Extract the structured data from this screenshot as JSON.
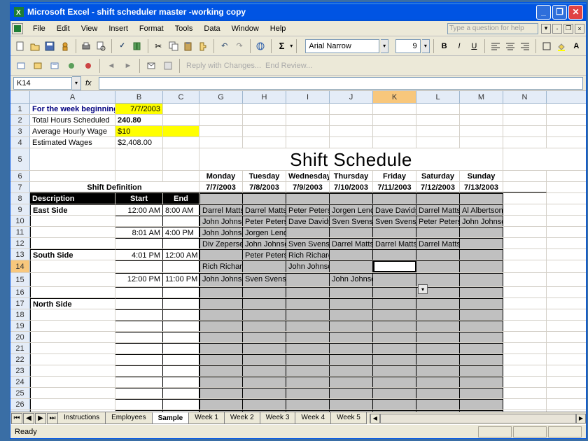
{
  "title": "Microsoft Excel - shift scheduler master -working copy",
  "menus": [
    "File",
    "Edit",
    "View",
    "Insert",
    "Format",
    "Tools",
    "Data",
    "Window",
    "Help"
  ],
  "helpPlaceholder": "Type a question for help",
  "font": {
    "name": "Arial Narrow",
    "size": "9"
  },
  "nameBox": "K14",
  "reviewBtn1": "Reply with Changes...",
  "reviewBtn2": "End Review...",
  "tabs": [
    "Instructions",
    "Employees",
    "Sample",
    "Week 1",
    "Week 2",
    "Week 3",
    "Week 4",
    "Week 5"
  ],
  "activeTab": "Sample",
  "status": "Ready",
  "columns": [
    "A",
    "B",
    "C",
    "G",
    "H",
    "I",
    "J",
    "K",
    "L",
    "M",
    "N"
  ],
  "activeCol": "K",
  "activeRow": "14",
  "sheet": {
    "r1": {
      "a": "For the week beginning:",
      "b": "7/7/2003"
    },
    "r2": {
      "a": "Total Hours Scheduled",
      "b": "240.80"
    },
    "r3": {
      "a": "Average Hourly Wage",
      "b": "$10"
    },
    "r4": {
      "a": "Estimated Wages",
      "b": "$2,408.00"
    },
    "title": "Shift Schedule",
    "days": [
      "Monday",
      "Tuesday",
      "Wednesday",
      "Thursday",
      "Friday",
      "Saturday",
      "Sunday"
    ],
    "dates": [
      "7/7/2003",
      "7/8/2003",
      "7/9/2003",
      "7/10/2003",
      "7/11/2003",
      "7/12/2003",
      "7/13/2003"
    ],
    "defHeader": "Shift Definition",
    "hdr": {
      "desc": "Description",
      "start": "Start",
      "end": "End"
    },
    "sections": [
      "East Side",
      "South Side",
      "North Side"
    ],
    "times": {
      "r9": {
        "start": "12:00 AM",
        "end": "8:00 AM"
      },
      "r11": {
        "start": "8:01 AM",
        "end": "4:00 PM"
      },
      "r13": {
        "start": "4:01 PM",
        "end": "12:00 AM"
      },
      "r15": {
        "start": "12:00 PM",
        "end": "11:00 PM"
      }
    },
    "assign": {
      "r9": [
        "Darrel Mattson",
        "Darrel Mattson",
        "Peter Peterson",
        "Jorgen Leno",
        "Dave Davidson",
        "Darrel Mattson",
        "Al Albertson"
      ],
      "r10": [
        "John Johnson",
        "Peter Peterson",
        "Dave Davidson",
        "Sven Svenson",
        "Sven Svenson",
        "Peter Peterson",
        "John Johnson"
      ],
      "r11": [
        "John Johnson",
        "Jorgen Leno",
        "",
        "",
        "",
        "",
        ""
      ],
      "r12": [
        "Div Zepersen",
        "John Johnson",
        "Sven Svenson",
        "Darrel Mattson",
        "Darrel Mattson",
        "Darrel Mattson",
        ""
      ],
      "r13": [
        "",
        "Peter Peterson",
        "Rich Richardson",
        "",
        "",
        "",
        ""
      ],
      "r14": [
        "Rich Richardson",
        "",
        "John Johnson",
        "",
        "",
        "",
        ""
      ],
      "r15": [
        "John Johnson",
        "Sven Svenson",
        "",
        "John Johnson",
        "",
        "",
        ""
      ]
    }
  }
}
